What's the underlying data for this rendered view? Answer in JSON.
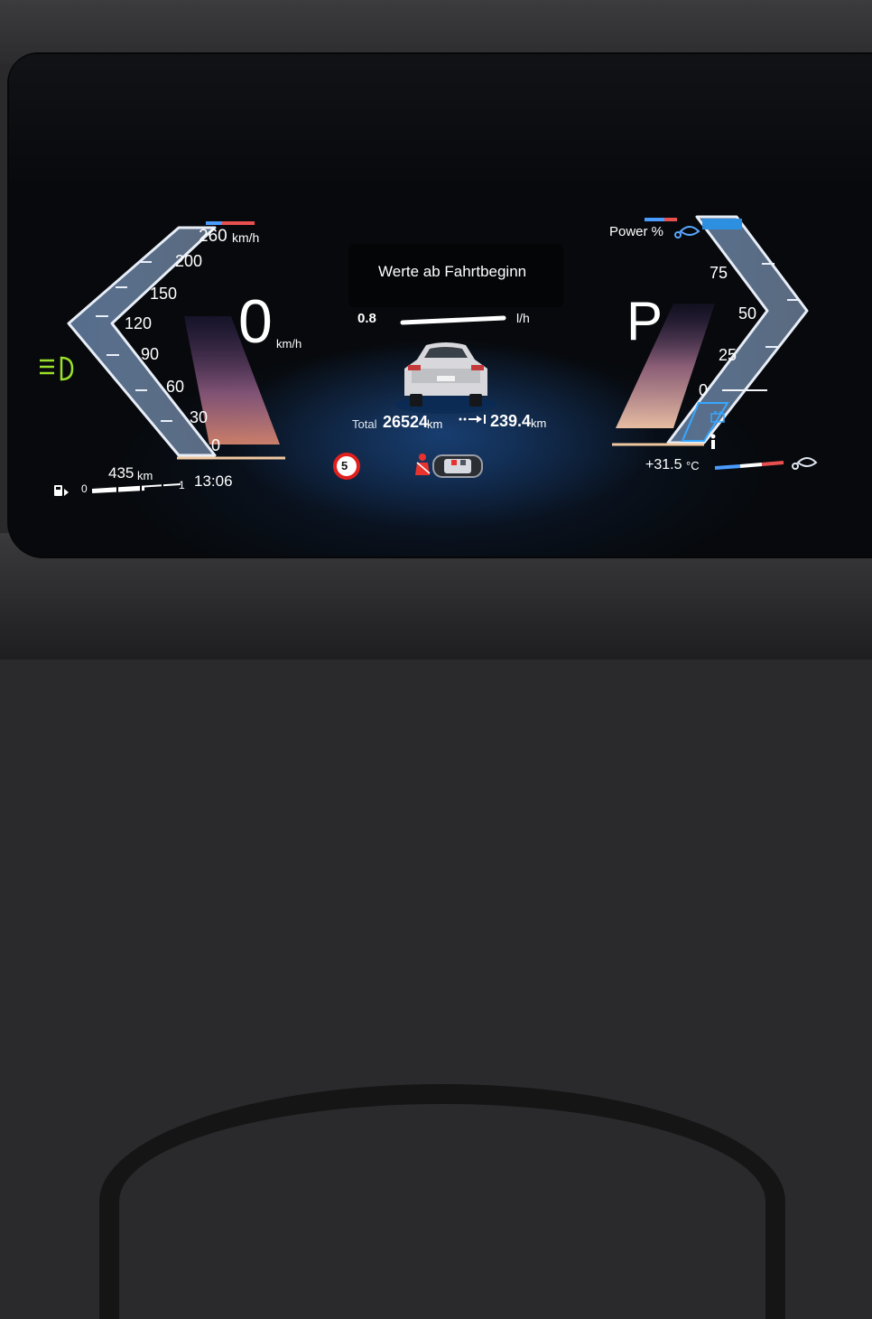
{
  "speedometer": {
    "scale": [
      "260",
      "200",
      "150",
      "120",
      "90",
      "60",
      "30",
      "0"
    ],
    "max_unit": "km/h",
    "speed": "0",
    "speed_unit": "km/h"
  },
  "center": {
    "caption": "Werte ab Fahrtbeginn",
    "consumption_value": "0.8",
    "consumption_unit": "l/h",
    "total_label": "Total",
    "total_value": "26524",
    "total_unit": "km",
    "trip_value": "239.4",
    "trip_unit": "km",
    "speed_limit": "5"
  },
  "power_gauge": {
    "title": "Power %",
    "scale": [
      "75",
      "50",
      "25",
      "0"
    ],
    "gear": "P"
  },
  "status_bar": {
    "range_value": "435",
    "range_unit": "km",
    "fuel_min": "0",
    "fuel_max": "1",
    "clock": "13:06",
    "outside_temp": "+31.5",
    "temp_unit": "°C"
  },
  "icons": [
    "headlight-icon",
    "fuel-pump-icon",
    "seatbelt-warning-icon",
    "car-top-view-icon",
    "car-rear-view-icon",
    "trip-arrow-icon",
    "eco-leaf-icon",
    "battery-icon"
  ],
  "colors": {
    "accent_blue": "#3aa0ff",
    "headlight_green": "#9be02a",
    "warning_red": "#e8322e"
  }
}
